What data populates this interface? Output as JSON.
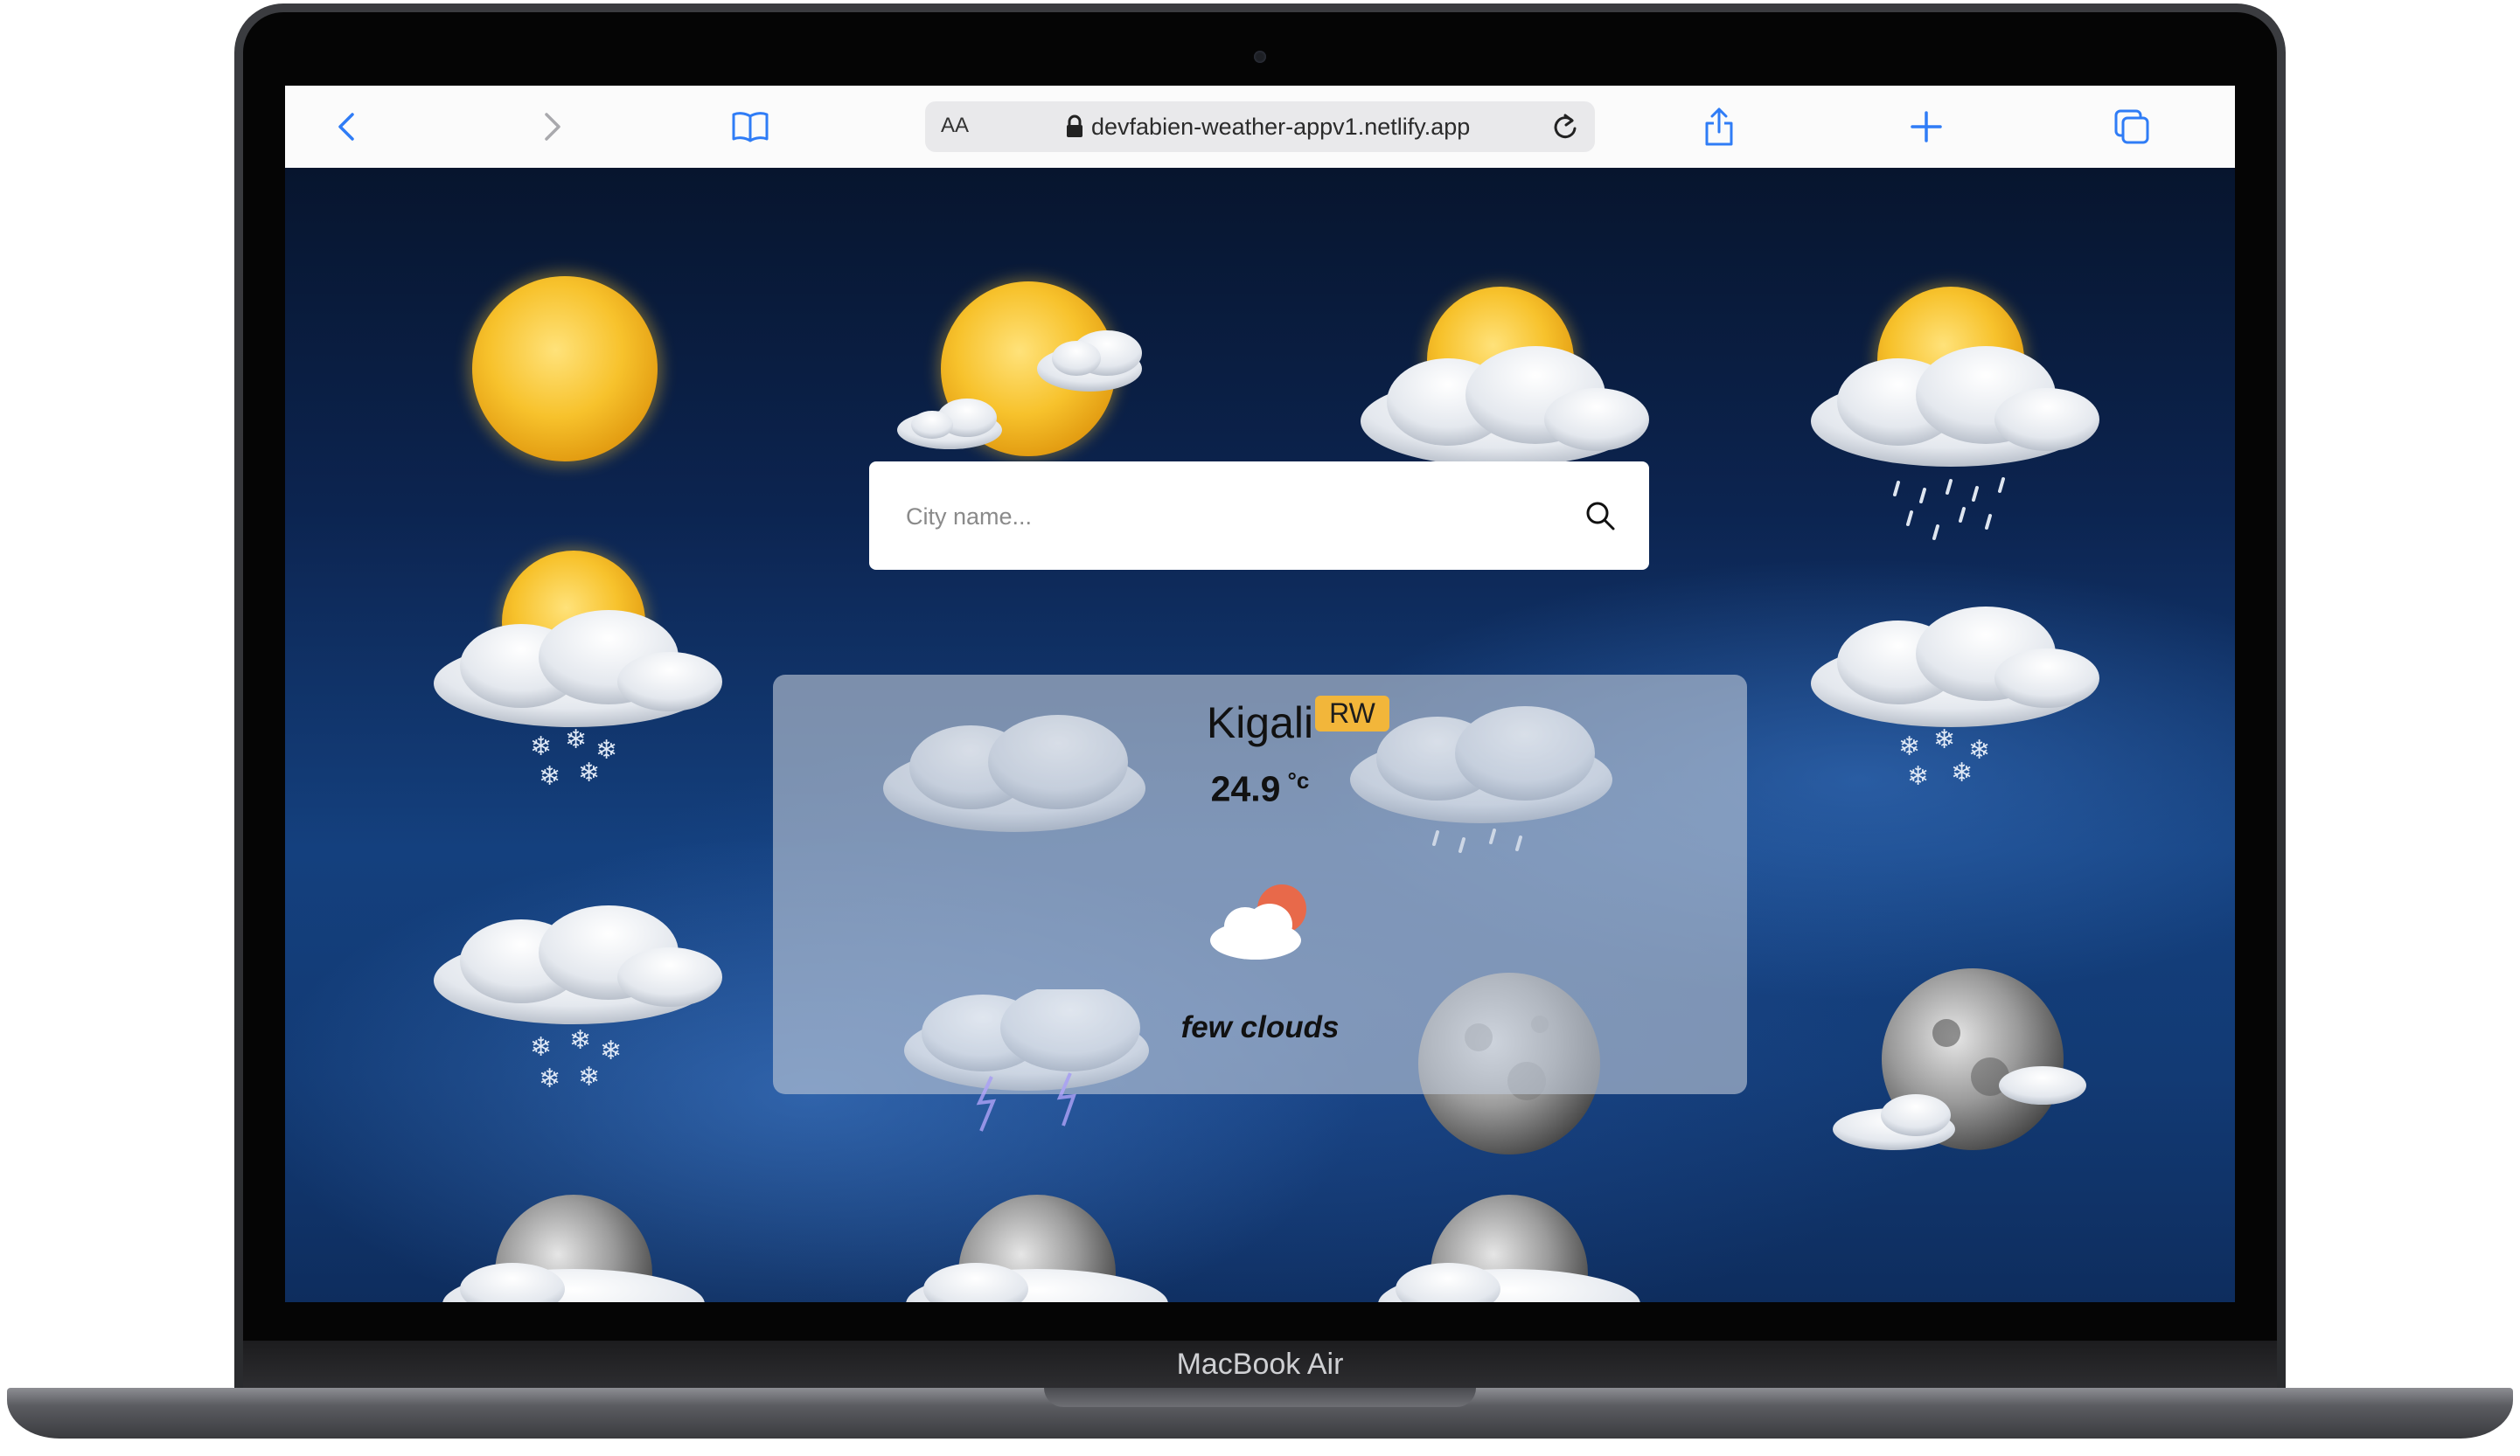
{
  "browser": {
    "address_bar": {
      "aa_label": "AA",
      "url": "devfabien-weather-appv1.netlify.app"
    },
    "icons": [
      "back-icon",
      "forward-icon",
      "bookmarks-icon",
      "lock-icon",
      "reload-icon",
      "share-icon",
      "new-tab-icon",
      "tabs-icon"
    ]
  },
  "device": {
    "label": "MacBook Air"
  },
  "search": {
    "placeholder": "City name..."
  },
  "weather": {
    "city": "Kigali",
    "country": "RW",
    "temperature": "24.9",
    "unit": "°c",
    "description": "few clouds",
    "icon": "few-clouds-icon"
  },
  "colors": {
    "accent_blue": "#2f7cf6",
    "country_badge": "#f2b63a",
    "sun_icon": "#e8694a"
  }
}
